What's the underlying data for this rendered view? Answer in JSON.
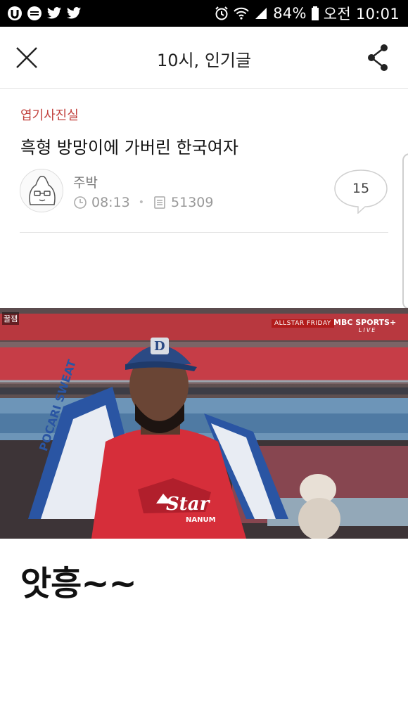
{
  "status_bar": {
    "battery": "84%",
    "time": "오전 10:01",
    "left_icons": [
      "u-app-icon",
      "ilove-pasta-icon",
      "twitter-icon",
      "twitter-icon"
    ],
    "right_icons": [
      "alarm-icon",
      "wifi-icon",
      "signal-icon",
      "battery-icon"
    ]
  },
  "header": {
    "title": "10시, 인기글"
  },
  "article": {
    "category": "엽기사진실",
    "title": "흑형 방망이에 가버린 한국여자",
    "author": "주박",
    "time": "08:13",
    "views": "51309",
    "comments": "15"
  },
  "video": {
    "watermark": "꿀잼",
    "event_label": "ALLSTAR FRIDAY",
    "channel": "MBC SPORTS+",
    "live_label": "LIVE",
    "cap_logo": "D",
    "jersey_text": "Star",
    "jersey_name": "NANUM",
    "towel_text": "POCARI SWEAT"
  },
  "body": {
    "caption": "앗흥~~"
  },
  "colors": {
    "category": "#c2423e",
    "status_bar_bg": "#000000"
  }
}
